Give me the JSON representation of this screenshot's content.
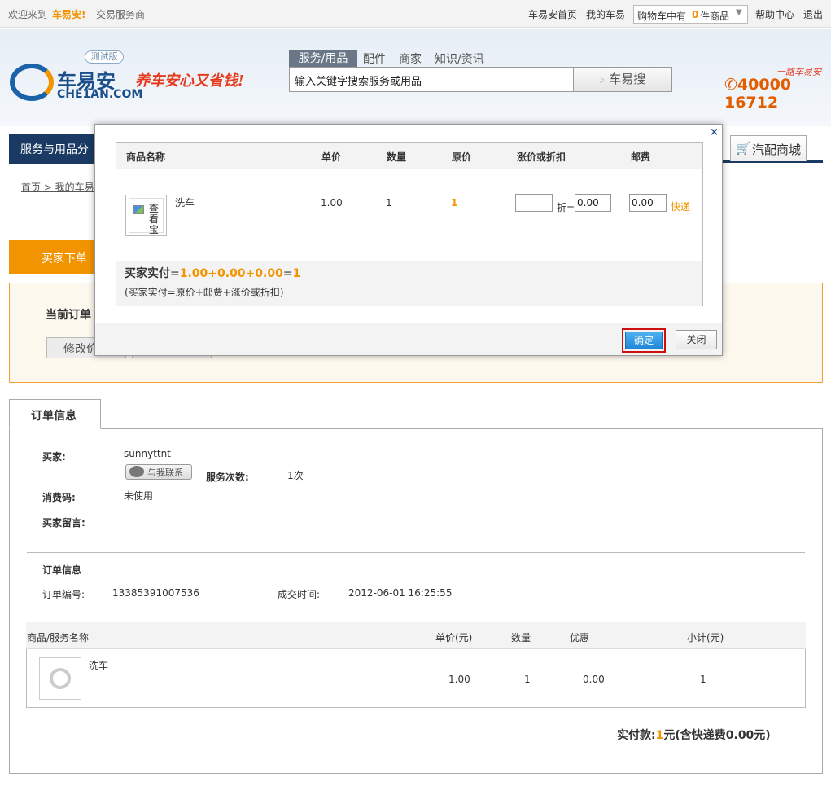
{
  "topbar": {
    "welcome": "欢迎来到",
    "brand": "车易安!",
    "service_provider": "交易服务商",
    "home_link": "车易安首页",
    "my_link": "我的车易",
    "cart_prefix": "购物车中有",
    "cart_count": "0",
    "cart_suffix": "件商品",
    "help_link": "帮助中心",
    "logout_link": "退出"
  },
  "header": {
    "logo_cn": "车易安",
    "logo_en": "CHE1AN.COM",
    "beta_badge": "测试版",
    "slogan": "养车安心又省钱!",
    "search_tabs": [
      "服务/用品",
      "配件",
      "商家",
      "知识/资讯"
    ],
    "search_placeholder": "输入关键字搜索服务或用品",
    "search_button": "车易搜",
    "phone_tagline": "一路车易安",
    "phone": "40000 16712"
  },
  "nav": {
    "left_label": "服务与用品分",
    "right_label": "汽配商城"
  },
  "breadcrumb": "首页 > 我的车易",
  "order": {
    "tab_label": "买家下单",
    "current_order_label": "当前订单",
    "modify_button": "修改价"
  },
  "info": {
    "tab_label": "订单信息",
    "buyer_label": "买家:",
    "buyer_name": "sunnyttnt",
    "contact_button": "与我联系",
    "service_count_label": "服务次数:",
    "service_count": "1次",
    "consume_code_label": "消费码:",
    "consume_code": "未使用",
    "message_label": "买家留言:",
    "section_title": "订单信息",
    "order_no_label": "订单编号:",
    "order_no": "13385391007536",
    "deal_time_label": "成交时间:",
    "deal_time": "2012-06-01 16:25:55",
    "table_headers": [
      "商品/服务名称",
      "单价(元)",
      "数量",
      "优惠",
      "小计(元)"
    ],
    "row": {
      "name": "洗车",
      "price": "1.00",
      "qty": "1",
      "discount": "0.00",
      "subtotal": "1"
    },
    "total_prefix": "实付款:",
    "total_amount": "1",
    "total_suffix": "元(含快递费0.00元)"
  },
  "modal": {
    "close_x": "×",
    "headers": [
      "商品名称",
      "单价",
      "数量",
      "原价",
      "涨价或折扣",
      "邮费"
    ],
    "thumb_text": "查看宝",
    "row": {
      "name": "洗车",
      "price": "1.00",
      "qty": "1",
      "orig": "1"
    },
    "discount_value": "",
    "discount_unit": "折=",
    "discount_result": "0.00",
    "postage_value": "0.00",
    "postage_type": "快递",
    "buyer_pay_label": "买家实付",
    "buyer_pay_eq": "=",
    "buyer_pay_formula": "1.00+0.00+0.00",
    "buyer_pay_eq2": "=",
    "buyer_pay_total": "1",
    "formula_note": "(买家实付=原价+邮费+涨价或折扣)",
    "confirm_button": "确定",
    "close_button": "关闭"
  },
  "colors": {
    "accent_orange": "#f29400",
    "nav_blue": "#1b3a63",
    "confirm_blue": "#1e88d8",
    "highlight_red": "#cc1010"
  }
}
